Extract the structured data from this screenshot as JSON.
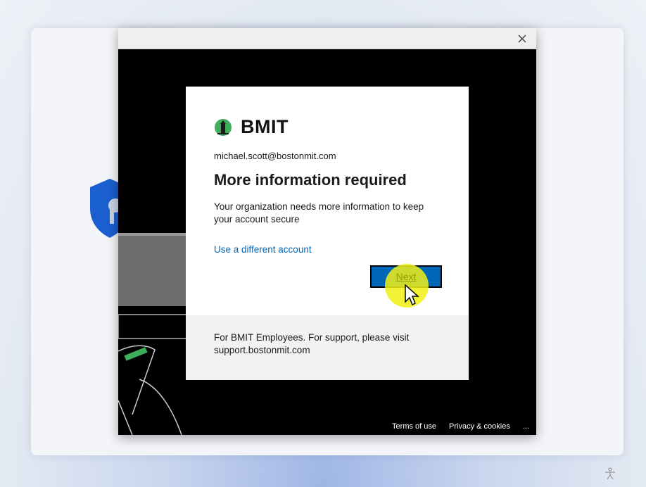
{
  "dialog": {
    "close_icon": "close-icon"
  },
  "card": {
    "brand": "BMIT",
    "email": "michael.scott@bostonmit.com",
    "heading": "More information required",
    "description": "Your organization needs more information to keep your account secure",
    "different_account_link": "Use a different account",
    "next_button": "Next",
    "footer": "For BMIT Employees. For support, please visit support.bostonmit.com"
  },
  "bottom_links": {
    "terms": "Terms of use",
    "privacy": "Privacy & cookies",
    "more": "..."
  },
  "colors": {
    "accent": "#0067b8",
    "highlight": "#f0f014",
    "logo_green": "#3fae5a"
  }
}
